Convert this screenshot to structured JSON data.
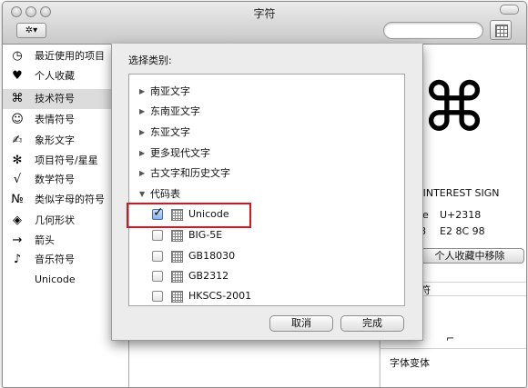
{
  "window": {
    "title": "字符"
  },
  "sidebar": {
    "items": [
      {
        "icon": "clock-icon",
        "glyph": "◷",
        "label": "最近使用的项目"
      },
      {
        "icon": "heart-icon",
        "glyph": "♥",
        "label": "个人收藏"
      },
      {
        "icon": "command-key-icon",
        "glyph": "⌘",
        "label": "技术符号"
      },
      {
        "icon": "smiley-icon",
        "glyph": "☺",
        "label": "表情符号"
      },
      {
        "icon": "pictograph-icon",
        "glyph": "✍",
        "label": "象形文字"
      },
      {
        "icon": "asterisk-icon",
        "glyph": "✻",
        "label": "项目符号/星星"
      },
      {
        "icon": "square-root-icon",
        "glyph": "√",
        "label": "数学符号"
      },
      {
        "icon": "numero-icon",
        "glyph": "№",
        "label": "类似字母的符号"
      },
      {
        "icon": "diamond-icon",
        "glyph": "◈",
        "label": "几何形状"
      },
      {
        "icon": "arrow-right-icon",
        "glyph": "→",
        "label": "箭头"
      },
      {
        "icon": "music-note-icon",
        "glyph": "♪",
        "label": "音乐符号"
      },
      {
        "icon": "unicode-icon",
        "glyph": "",
        "label": "Unicode"
      }
    ],
    "selected_index": 2
  },
  "sheet": {
    "label": "选择类别:",
    "groups": [
      "南亚文字",
      "东南亚文字",
      "东亚文字",
      "更多现代文字",
      "古文字和历史文字"
    ],
    "expanded_group": "代码表",
    "code_tables": [
      {
        "label": "Unicode",
        "checked": true
      },
      {
        "label": "BIG-5E",
        "checked": false
      },
      {
        "label": "GB18030",
        "checked": false
      },
      {
        "label": "GB2312",
        "checked": false
      },
      {
        "label": "HKSCS-2001",
        "checked": false
      }
    ],
    "cancel_label": "取消",
    "done_label": "完成"
  },
  "detail": {
    "glyph": "⌘",
    "name_fragment": "CE OF INTEREST SIGN",
    "unicode_prefix": "de",
    "unicode_value": "U+2318",
    "utf8_prefix": "-8",
    "utf8_value": "E2 8C 98",
    "remove_favorite_label": "个人收藏中移除",
    "section_fragment": "符",
    "variants_label": "字体变体"
  },
  "bottom_glyphs": [
    "⌛",
    "⎗",
    "⎘",
    "⏏",
    "⬭"
  ]
}
